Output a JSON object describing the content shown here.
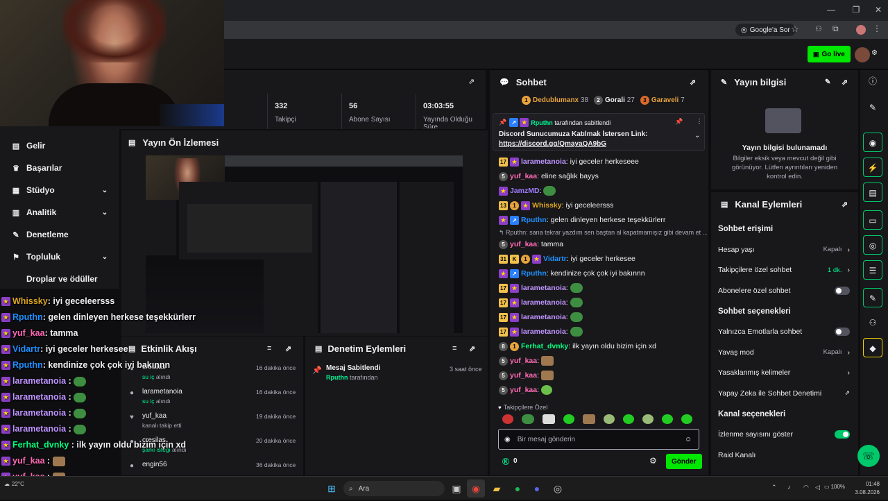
{
  "browser": {
    "address_actions": [
      "Google'a Sor"
    ]
  },
  "topnav": {
    "go_live": "Go live"
  },
  "stats": [
    {
      "value": "332",
      "label": "Takipçi"
    },
    {
      "value": "56",
      "label": "Abone Sayısı"
    },
    {
      "value": "03:03:55",
      "label": "Yayında Olduğu Süre"
    }
  ],
  "sidebar": {
    "items": [
      {
        "label": "Gelir",
        "icon": "revenue-icon"
      },
      {
        "label": "Başarılar",
        "icon": "trophy-icon"
      },
      {
        "label": "Stüdyo",
        "icon": "studio-icon",
        "expandable": true
      },
      {
        "label": "Analitik",
        "icon": "analytics-icon",
        "expandable": true
      },
      {
        "label": "Denetleme",
        "icon": "wrench-icon"
      },
      {
        "label": "Topluluk",
        "icon": "community-icon",
        "expandable": true
      },
      {
        "label": "Droplar ve ödüller",
        "icon": "drops-icon"
      }
    ]
  },
  "preview": {
    "title": "Yayın Ön İzlemesi"
  },
  "activity": {
    "title": "Etkinlik Akışı",
    "events": [
      {
        "user": "cresilas",
        "action": "su iç alındı",
        "time": "16 dakika önce",
        "act": "su iç"
      },
      {
        "user": "larametanoia",
        "action": "su iç alındı",
        "time": "16 dakika önce",
        "act": "su iç"
      },
      {
        "user": "yuf_kaa",
        "action": "kanalı takip etti",
        "time": "19 dakika önce",
        "act": ""
      },
      {
        "user": "cresilas",
        "action": "şarkı isteği alındı",
        "time": "20 dakika önce",
        "act": "şarkı isteği"
      },
      {
        "user": "engin56",
        "action": "",
        "time": "36 dakika önce",
        "act": ""
      }
    ]
  },
  "moderation": {
    "title": "Denetim Eylemleri",
    "entry_title": "Mesaj Sabitlendi",
    "entry_user": "Rputhn",
    "entry_suffix": "tarafından",
    "entry_time": "3 saat önce"
  },
  "chat": {
    "title": "Sohbet",
    "leaders": [
      {
        "rank": "1",
        "name": "Dedublumanx",
        "count": "38"
      },
      {
        "rank": "2",
        "name": "Gorali",
        "count": "27"
      },
      {
        "rank": "3",
        "name": "Garaveli",
        "count": "7"
      }
    ],
    "pinned": {
      "by": "Rputhn",
      "by_suffix": "tarafından sabitlendi",
      "text": "Discord Sunucumuza Katılmak İstersen Link:",
      "link": "https://discord.gg/QmayaQA9bG"
    },
    "messages": [
      {
        "badges": [
          "17",
          "star"
        ],
        "user": "larametanoia",
        "color": "#bf94ff",
        "text": "iyi geceler herkeseee",
        "emote": ""
      },
      {
        "badges": [
          "5c"
        ],
        "user": "yuf_kaa",
        "color": "#ff69b4",
        "text": "eline sağlık bayys",
        "emote": ""
      },
      {
        "badges": [
          "star"
        ],
        "user": "JamzMD",
        "color": "#9d7bff",
        "text": "",
        "emote": "frog"
      },
      {
        "badges": [
          "13",
          "gold",
          "star"
        ],
        "user": "Whissky",
        "color": "#daa520",
        "text": "iyi geceleersss",
        "emote": ""
      },
      {
        "badges": [
          "star",
          "blue"
        ],
        "user": "Rputhn",
        "color": "#1e90ff",
        "text": "gelen dinleyen herkese teşekkürlerr",
        "emote": ""
      },
      {
        "reply": "Rputhn: sana tekrar yazdım sen baştan al kapatmamışız gibi devam et ..."
      },
      {
        "badges": [
          "5c"
        ],
        "user": "yuf_kaa",
        "color": "#ff69b4",
        "text": "tamma",
        "emote": ""
      },
      {
        "badges": [
          "31",
          "k",
          "gold",
          "star"
        ],
        "user": "Vidartr",
        "color": "#1e90ff",
        "text": "iyi geceler herkesee",
        "emote": ""
      },
      {
        "badges": [
          "star",
          "blue"
        ],
        "user": "Rputhn",
        "color": "#1e90ff",
        "text": "kendinize çok çok iyi bakınnn",
        "emote": ""
      },
      {
        "badges": [
          "17",
          "star"
        ],
        "user": "larametanoia",
        "color": "#bf94ff",
        "text": "",
        "emote": "frog"
      },
      {
        "badges": [
          "17",
          "star"
        ],
        "user": "larametanoia",
        "color": "#bf94ff",
        "text": "",
        "emote": "frog"
      },
      {
        "badges": [
          "17",
          "star"
        ],
        "user": "larametanoia",
        "color": "#bf94ff",
        "text": "",
        "emote": "frog"
      },
      {
        "badges": [
          "17",
          "star"
        ],
        "user": "larametanoia",
        "color": "#bf94ff",
        "text": "",
        "emote": "frog"
      },
      {
        "badges": [
          "8c",
          "gold"
        ],
        "user": "Ferhat_dvnky",
        "color": "#00ff7f",
        "text": "ilk yayın oldu bizim için xd",
        "emote": ""
      },
      {
        "badges": [
          "5c"
        ],
        "user": "yuf_kaa",
        "color": "#ff69b4",
        "text": "",
        "emote": "cat"
      },
      {
        "badges": [
          "5c"
        ],
        "user": "yuf_kaa",
        "color": "#ff69b4",
        "text": "",
        "emote": "cat"
      },
      {
        "badges": [
          "5c"
        ],
        "user": "yuf_kaa",
        "color": "#ff69b4",
        "text": "",
        "emote": "face"
      }
    ],
    "followers_only": "Takipçilere Özel",
    "input_placeholder": "Bir mesaj gönderin",
    "points": "0",
    "send": "Gönder"
  },
  "stream_info": {
    "title": "Yayın bilgisi",
    "empty_title": "Yayın bilgisi bulunamadı",
    "empty_text": "Bilgiler eksik veya mevcut değil gibi görünüyor. Lütfen ayrıntıları yeniden kontrol edin."
  },
  "channel_actions": {
    "title": "Kanal Eylemleri",
    "sections": [
      {
        "heading": "Sohbet erişimi",
        "rows": [
          {
            "label": "Hesap yaşı",
            "value": "Kapalı",
            "control": "chevron"
          },
          {
            "label": "Takipçilere özel sohbet",
            "value": "1 dk.",
            "control": "chevron"
          },
          {
            "label": "Abonelere özel sohbet",
            "value": "",
            "control": "toggle-off"
          }
        ]
      },
      {
        "heading": "Sohbet seçenekleri",
        "rows": [
          {
            "label": "Yalnızca Emotlarla sohbet",
            "value": "",
            "control": "toggle-off"
          },
          {
            "label": "Yavaş mod",
            "value": "Kapalı",
            "control": "chevron"
          },
          {
            "label": "Yasaklanmış kelimeler",
            "value": "",
            "control": "chevron"
          },
          {
            "label": "Yapay Zeka ile Sohbet Denetimi",
            "value": "",
            "control": "external"
          }
        ]
      },
      {
        "heading": "Kanal seçenekleri",
        "rows": [
          {
            "label": "İzlenme sayısını göster",
            "value": "",
            "control": "toggle-on"
          },
          {
            "label": "Raid Kanalı",
            "value": "",
            "control": "none"
          }
        ]
      }
    ]
  },
  "overlay_chat": [
    {
      "user": "Whissky",
      "color": "#daa520",
      "text": ": iyi geceleersss",
      "emote": ""
    },
    {
      "user": "Rputhn",
      "color": "#1e90ff",
      "text": ": gelen dinleyen herkese teşekkürlerr",
      "emote": ""
    },
    {
      "user": "yuf_kaa",
      "color": "#ff69b4",
      "text": ": tamma",
      "emote": ""
    },
    {
      "user": "Vidartr",
      "color": "#1e90ff",
      "text": ": iyi geceler herkesee",
      "emote": ""
    },
    {
      "user": "Rputhn",
      "color": "#1e90ff",
      "text": ": kendinize çok çok iyi bakınnn",
      "emote": ""
    },
    {
      "user": "larametanoia",
      "color": "#bf94ff",
      "text": " :",
      "emote": "frog"
    },
    {
      "user": "larametanoia",
      "color": "#bf94ff",
      "text": " :",
      "emote": "frog"
    },
    {
      "user": "larametanoia",
      "color": "#bf94ff",
      "text": " :",
      "emote": "frog"
    },
    {
      "user": "larametanoia",
      "color": "#bf94ff",
      "text": " :",
      "emote": "frog"
    },
    {
      "user": "Ferhat_dvnky",
      "color": "#00ff7f",
      "text": " : ilk yayın oldu bizim için xd",
      "emote": ""
    },
    {
      "user": "yuf_kaa",
      "color": "#ff69b4",
      "text": " :",
      "emote": "cat"
    },
    {
      "user": "yuf_kaa",
      "color": "#ff69b4",
      "text": " :",
      "emote": "cat"
    },
    {
      "user": "yuf_kaa",
      "color": "#ff69b4",
      "text": " :",
      "emote": "face"
    }
  ],
  "taskbar": {
    "search": "Ara",
    "weather": "22°C",
    "time": "01:48",
    "date": "3.08.2026",
    "battery": "100%"
  },
  "colors": {
    "accent": "#00e701",
    "panel": "#18181b",
    "bg": "#0e0e10"
  }
}
